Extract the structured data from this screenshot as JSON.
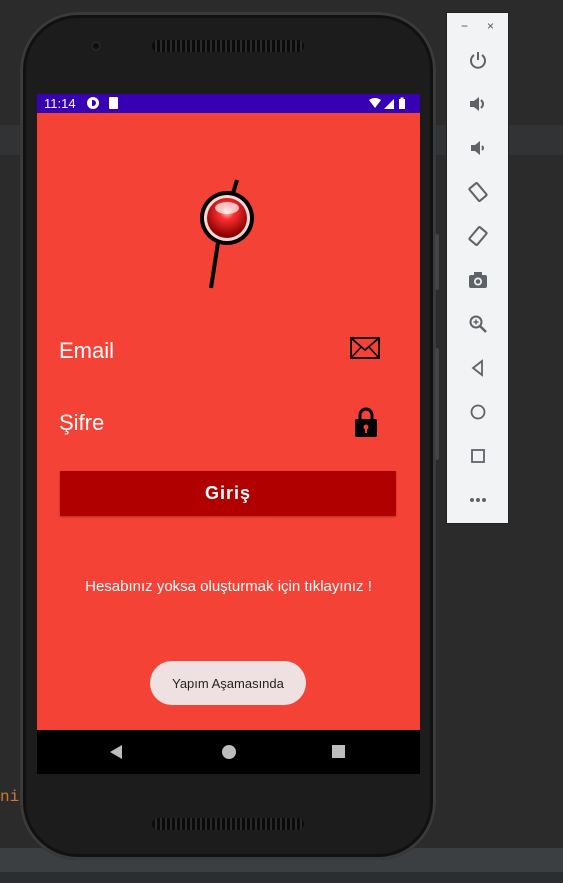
{
  "ide": {
    "code_fragment": "ni"
  },
  "statusbar": {
    "time": "11:14"
  },
  "login": {
    "email_label": "Email",
    "password_label": "Şifre",
    "login_button": "Giriş",
    "register_link": "Hesabınız yoksa oluşturmak için tıklayınız !",
    "toast": "Yapım Aşamasında"
  },
  "colors": {
    "screen_background": "#f44336",
    "status_bar": "#3700b3",
    "login_button": "#b00000",
    "toast_background": "#efe1e1"
  },
  "icons": {
    "email": "envelope-icon",
    "password": "lock-icon",
    "logo": "red-button-pin-icon"
  },
  "emulator": {
    "minimize": "−",
    "close": "×",
    "tools": [
      "power-icon",
      "volume-up-icon",
      "volume-down-icon",
      "rotate-left-icon",
      "rotate-right-icon",
      "camera-icon",
      "zoom-icon",
      "back-icon",
      "home-icon",
      "overview-icon",
      "more-icon"
    ]
  }
}
